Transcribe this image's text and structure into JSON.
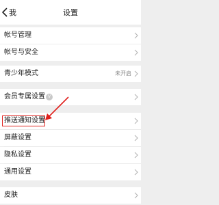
{
  "nav": {
    "back_label": "我",
    "title": "设置"
  },
  "rows": {
    "account_management": {
      "label": "帐号管理"
    },
    "account_security": {
      "label": "帐号与安全"
    },
    "teen_mode": {
      "label": "青少年模式",
      "value": "未开启"
    },
    "member_settings": {
      "label": "会员专属设置",
      "badge": "V"
    },
    "push_notifications": {
      "label": "推送通知设置"
    },
    "blocking": {
      "label": "屏蔽设置"
    },
    "privacy": {
      "label": "隐私设置"
    },
    "general": {
      "label": "通用设置"
    },
    "skin": {
      "label": "皮肤"
    }
  },
  "annotation": {
    "color": "#e0201c"
  }
}
